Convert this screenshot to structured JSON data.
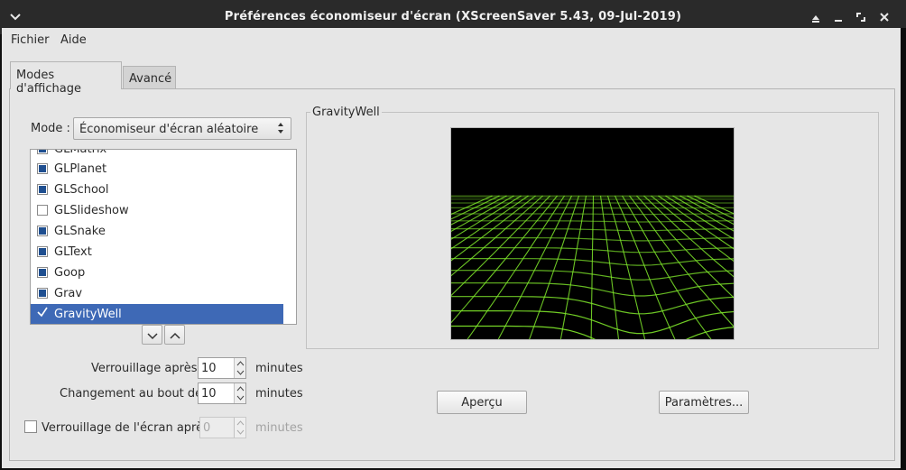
{
  "window": {
    "title": "Préférences économiseur d'écran  (XScreenSaver 5.43, 09-Jul-2019)",
    "menu_icon": "chevron-down-icon",
    "controls": [
      "shade-icon",
      "minimize-icon",
      "maximize-icon",
      "close-icon"
    ]
  },
  "menubar": {
    "file": "Fichier",
    "help": "Aide"
  },
  "tabs": {
    "display_modes": "Modes d'affichage",
    "advanced": "Avancé"
  },
  "mode": {
    "label": "Mode :",
    "value": "Économiseur d'écran aléatoire"
  },
  "list": {
    "partial_item": "GLMatrix",
    "items": [
      {
        "label": "GLPlanet",
        "checked": true
      },
      {
        "label": "GLSchool",
        "checked": true
      },
      {
        "label": "GLSlideshow",
        "checked": false
      },
      {
        "label": "GLSnake",
        "checked": true
      },
      {
        "label": "GLText",
        "checked": true
      },
      {
        "label": "Goop",
        "checked": true
      },
      {
        "label": "Grav",
        "checked": true
      },
      {
        "label": "GravityWell",
        "checked": true,
        "selected": true
      }
    ]
  },
  "lock": {
    "label": "Verrouillage après",
    "value": "10",
    "unit": "minutes"
  },
  "cycle": {
    "label": "Changement au bout de",
    "value": "10",
    "unit": "minutes"
  },
  "screen_lock": {
    "label": "Verrouillage de l'écran après",
    "value": "0",
    "unit": "minutes",
    "checked": false
  },
  "preview": {
    "frame_label": "GravityWell"
  },
  "buttons": {
    "preview": "Aperçu",
    "settings": "Paramètres..."
  },
  "colors": {
    "selection": "#3e69b6",
    "titlebar": "#2a2a2a",
    "grid": "#7ee62a"
  }
}
